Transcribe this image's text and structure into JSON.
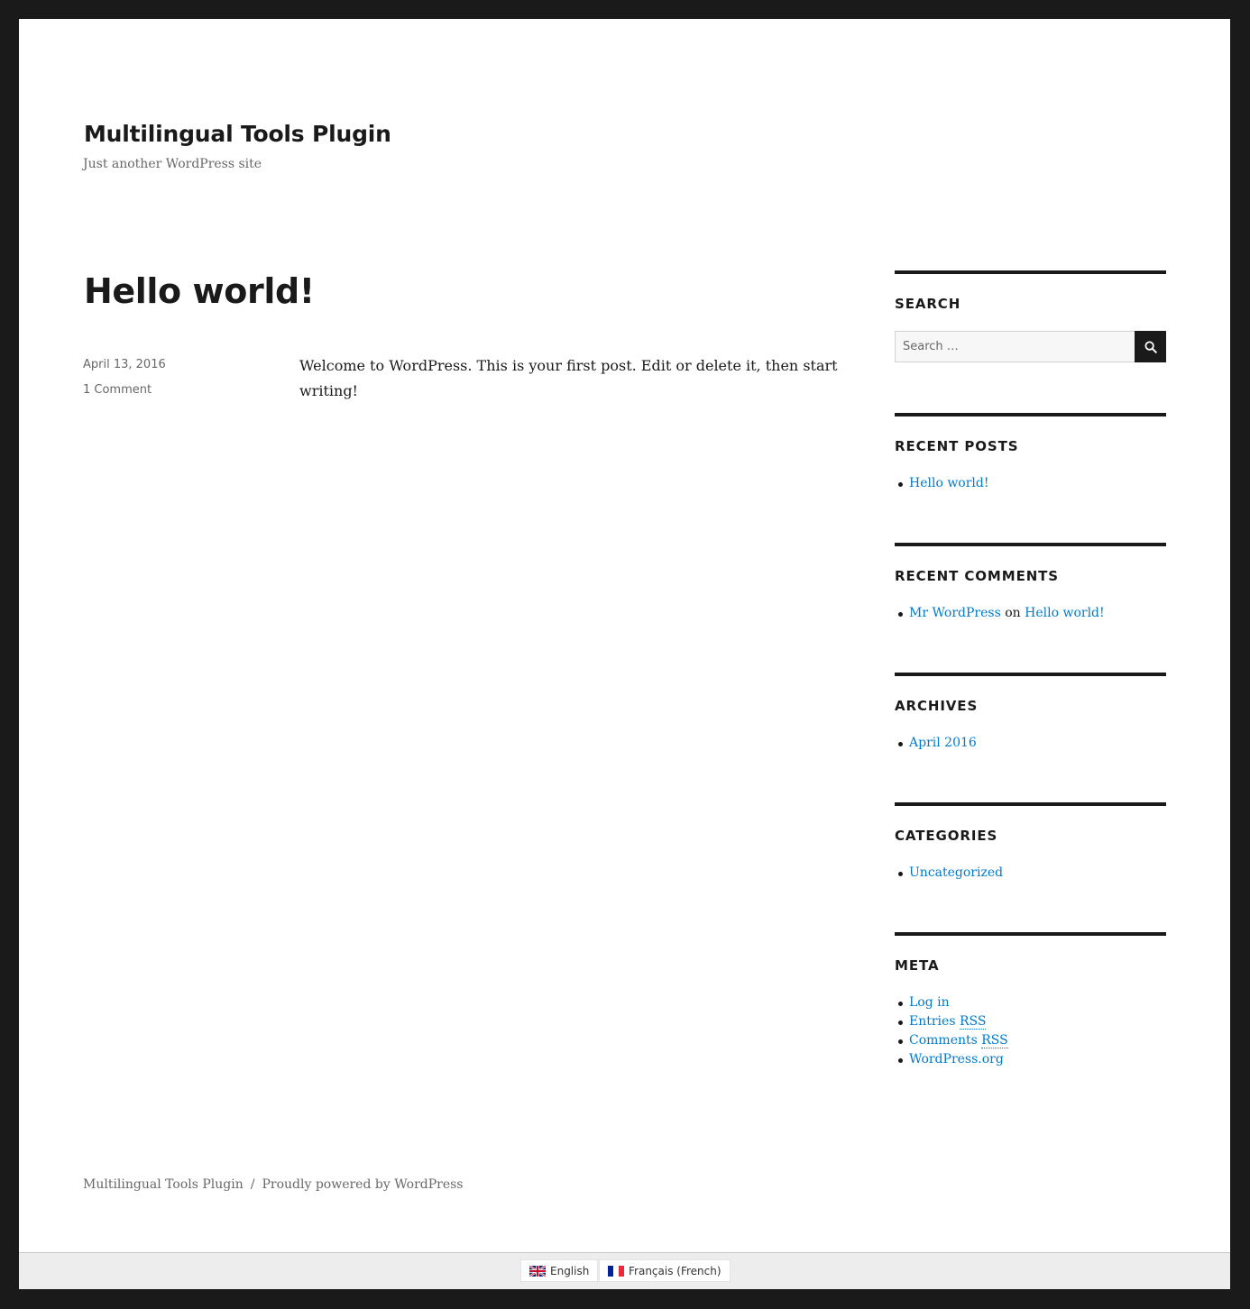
{
  "site": {
    "title": "Multilingual Tools Plugin",
    "tagline": "Just another WordPress site"
  },
  "post": {
    "title": "Hello world!",
    "date": "April 13, 2016",
    "comments_link": "1 Comment",
    "content": "Welcome to WordPress. This is your first post. Edit or delete it, then start writing!"
  },
  "sidebar": {
    "search": {
      "heading": "SEARCH",
      "placeholder": "Search …",
      "button_icon": "search-icon"
    },
    "recent_posts": {
      "heading": "RECENT POSTS",
      "items": [
        "Hello world!"
      ]
    },
    "recent_comments": {
      "heading": "RECENT COMMENTS",
      "items": [
        {
          "author": "Mr WordPress",
          "connector": "on",
          "post": "Hello world!"
        }
      ]
    },
    "archives": {
      "heading": "ARCHIVES",
      "items": [
        "April 2016"
      ]
    },
    "categories": {
      "heading": "CATEGORIES",
      "items": [
        "Uncategorized"
      ]
    },
    "meta": {
      "heading": "META",
      "items": [
        {
          "text": "Log in"
        },
        {
          "text": "Entries ",
          "abbr": "RSS"
        },
        {
          "text": "Comments ",
          "abbr": "RSS"
        },
        {
          "text": "WordPress.org"
        }
      ]
    }
  },
  "footer": {
    "site_name": "Multilingual Tools Plugin",
    "separator": "/",
    "powered_by": "Proudly powered by WordPress"
  },
  "language_switcher": {
    "languages": [
      {
        "label": "English",
        "flag_icon": "uk-flag-icon"
      },
      {
        "label": "Français (French)",
        "flag_icon": "france-flag-icon"
      }
    ]
  },
  "colors": {
    "text": "#1a1a1a",
    "muted": "#686868",
    "link": "#007acc",
    "frame": "#1a1a1a",
    "lang_bar": "#ededed"
  }
}
